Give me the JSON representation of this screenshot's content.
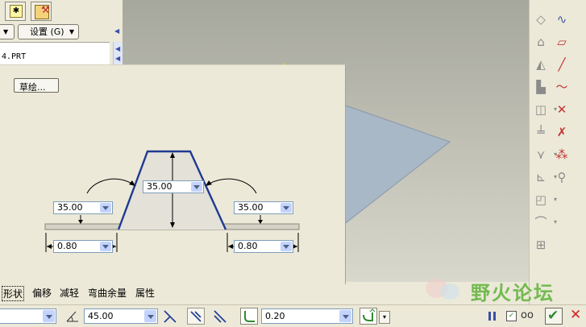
{
  "top": {
    "settings_label": "设置 (G)",
    "part_name": "4.PRT"
  },
  "panel": {
    "sketch_button": "草绘...",
    "dim_left": "35.00",
    "dim_center": "35.00",
    "dim_right": "35.00",
    "thick_left": "0.80",
    "thick_right": "0.80"
  },
  "tabs": [
    "形状",
    "偏移",
    "减轻",
    "弯曲余量",
    "属性"
  ],
  "bottom": {
    "angle_value": "45.00",
    "radius_value": "0.20"
  },
  "watermark": "野火论坛",
  "colors": {
    "accent": "#1f3a93",
    "face": "#a9b8c6",
    "ok": "#2f8a2f",
    "cancel": "#d12424"
  },
  "icons": {
    "right_toolbar": [
      "datum-plane-icon",
      "sine-curve-icon",
      "sheet-metal-wall-icon",
      "parallelogram-icon",
      "flange-icon",
      "line-slash-icon",
      "extrude-wall-icon",
      "sketch-curve-icon",
      "flat-wall-icon",
      "datum-point-icon",
      "cut-icon",
      "coordinate-system-icon",
      "bend-icon",
      "point-offset-icon",
      "unbend-icon",
      "analysis-icon",
      "corner-relief-icon",
      "rip-icon",
      "pattern-icon"
    ]
  }
}
